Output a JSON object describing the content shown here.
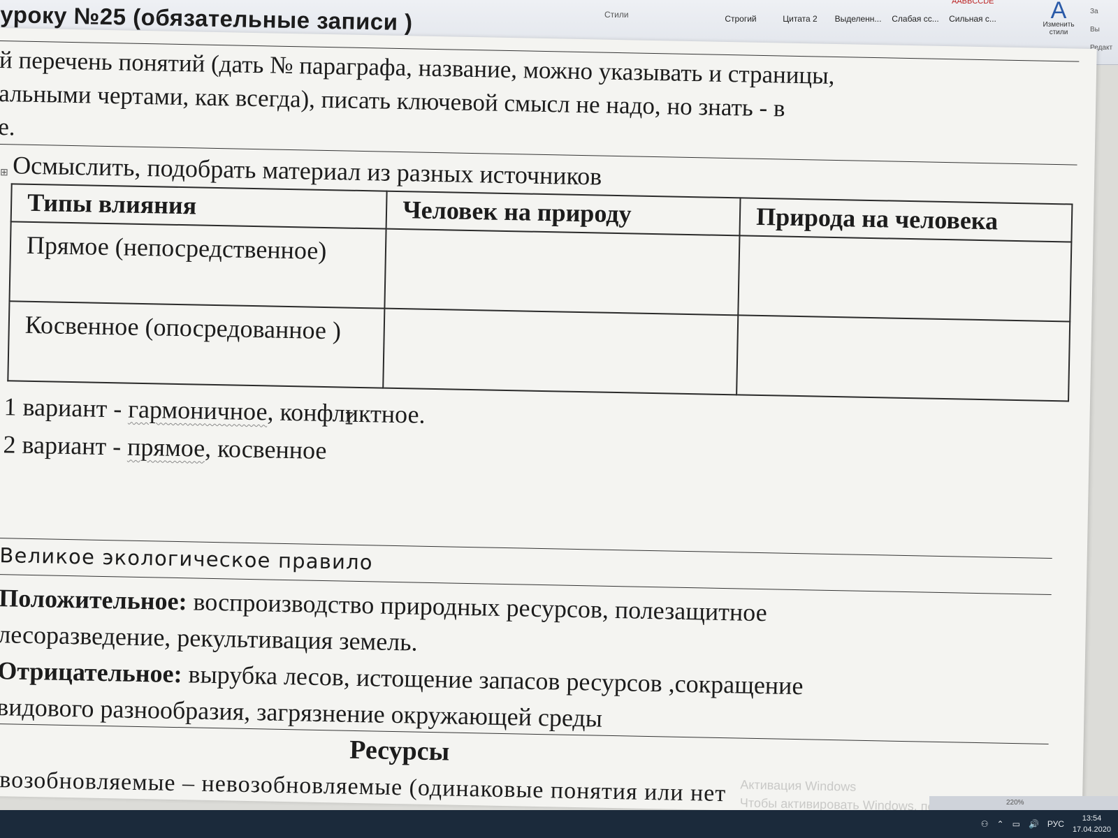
{
  "ribbon": {
    "group_label": "Стили",
    "styles": [
      {
        "label": "Строгий",
        "preview": ""
      },
      {
        "label": "Цитата 2",
        "preview": ""
      },
      {
        "label": "Выделенн...",
        "preview": ""
      },
      {
        "label": "Слабая сс...",
        "preview": ""
      },
      {
        "label": "Сильная с...",
        "preview": "AABBCCDE"
      }
    ],
    "change_styles_label": "Изменить стили",
    "right_tools": [
      "За",
      "Вы",
      "Редакт"
    ]
  },
  "document": {
    "title": "уроку №25 (обязательные записи )",
    "intro_lines": [
      "й перечень понятий (дать № параграфа, название, можно указывать и страницы,",
      "альными чертами, как всегда), писать ключевой смысл не надо, но знать -  в",
      "е."
    ],
    "task": "Осмыслить, подобрать материал из разных источников",
    "table": {
      "headers": [
        "Типы влияния",
        "Человек  на природу",
        "Природа на человека"
      ],
      "rows": [
        [
          "Прямое (непосредственное)",
          "",
          ""
        ],
        [
          "Косвенное (опосредованное )",
          "",
          ""
        ]
      ]
    },
    "variants": [
      {
        "prefix": "1 вариант -  ",
        "word1": "гармоничное",
        "rest": ",  конфликтное."
      },
      {
        "prefix": "2 вариант  - ",
        "word1": "прямое",
        "rest": ", косвенное"
      }
    ],
    "rule_heading": "Великое экологическое правило",
    "positive_label": "Положительное:",
    "positive_line1": " воспроизводство природных ресурсов, полезащитное",
    "positive_line2": "лесоразведение,  рекультивация земель.",
    "negative_label": "Отрицательное:",
    "negative_line1": " вырубка лесов,  истощение  запасов ресурсов ,сокращение",
    "negative_line2": "видового разнообразия, загрязнение окружающей  среды",
    "resources_title": "Ресурсы",
    "resources_line": "возобновляемые  –  невозобновляемые (одинаковые понятия  или нет"
  },
  "watermark": {
    "line1": "Активация Windows",
    "line2": "Чтобы активировать Windows, перейдите в раздел \"Параметры\""
  },
  "status": {
    "zoom": "220%"
  },
  "taskbar": {
    "lang": "РУС",
    "time": "13:54",
    "date": "17.04.2020"
  }
}
